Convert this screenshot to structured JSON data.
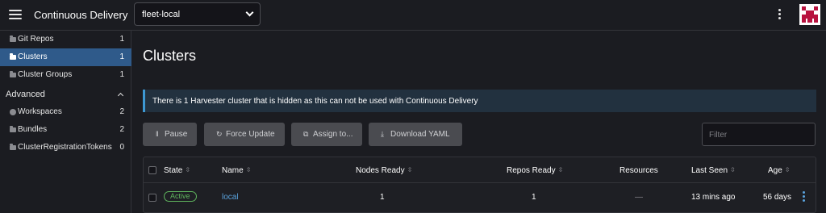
{
  "header": {
    "app_title": "Continuous Delivery",
    "workspace": "fleet-local"
  },
  "sidebar": {
    "items": [
      {
        "label": "Git Repos",
        "count": "1",
        "icon": "folder-icon"
      },
      {
        "label": "Clusters",
        "count": "1",
        "icon": "folder-icon",
        "active": true
      },
      {
        "label": "Cluster Groups",
        "count": "1",
        "icon": "folder-icon"
      }
    ],
    "advanced": {
      "label": "Advanced",
      "items": [
        {
          "label": "Workspaces",
          "count": "2",
          "icon": "globe-icon"
        },
        {
          "label": "Bundles",
          "count": "2",
          "icon": "folder-icon"
        },
        {
          "label": "ClusterRegistrationTokens",
          "count": "0",
          "icon": "folder-icon"
        }
      ]
    }
  },
  "main": {
    "title": "Clusters",
    "banner": "There is 1 Harvester cluster that is hidden as this can not be used with Continuous Delivery",
    "actions": {
      "pause": {
        "icon": "‖",
        "label": "Pause"
      },
      "force_update": {
        "icon": "↻",
        "label": "Force Update"
      },
      "assign_to": {
        "icon": "⧉",
        "label": "Assign to..."
      },
      "download_yaml": {
        "icon": "⤓",
        "label": "Download YAML"
      }
    },
    "filter_placeholder": "Filter"
  },
  "table": {
    "columns": {
      "state": "State",
      "name": "Name",
      "nodes_ready": "Nodes Ready",
      "repos_ready": "Repos Ready",
      "resources": "Resources",
      "last_seen": "Last Seen",
      "age": "Age"
    },
    "rows": [
      {
        "state": "Active",
        "name": "local",
        "nodes_ready": "1",
        "repos_ready": "1",
        "resources": "—",
        "last_seen": "13 mins ago",
        "age": "56 days"
      }
    ]
  },
  "colors": {
    "accent": "#2f5a8a",
    "link": "#5aa2dc",
    "status_active": "#5fb45d",
    "banner_border": "#3d98d3"
  }
}
